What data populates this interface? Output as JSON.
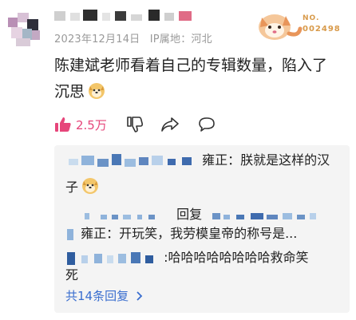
{
  "post": {
    "date": "2023年12月14日",
    "ip_location": "IP属地：河北",
    "badge": {
      "no_label": "NO.",
      "number": "002498"
    },
    "comment_text_line1": "陈建斌老师看着自己的专辑数量，陷入了",
    "comment_text_line2": "沉思",
    "like_count": "2.5万"
  },
  "replies": [
    {
      "text_line1": "雍正：朕就是这样的汉",
      "text_line2": "子"
    },
    {
      "reply_label": "回复",
      "text": "雍正：开玩笑，我劳模皇帝的称号是..."
    },
    {
      "text_line1": ":哈哈哈哈哈哈哈哈救命笑",
      "text_line2": "死"
    }
  ],
  "more_replies_label": "共14条回复",
  "icons": {
    "like": "thumbs-up-icon",
    "dislike": "thumbs-down-icon",
    "share": "share-icon",
    "reply": "comment-bubble-icon",
    "emoji": "doge-emoji-icon",
    "more_chevron": "chevron-right-icon",
    "badge": "fox-badge-icon"
  },
  "colors": {
    "like_accent": "#e6457a",
    "link": "#3a6ecf",
    "meta_text": "#999999",
    "reply_bg": "#f4f4f4",
    "badge_text": "#d89a4a"
  }
}
